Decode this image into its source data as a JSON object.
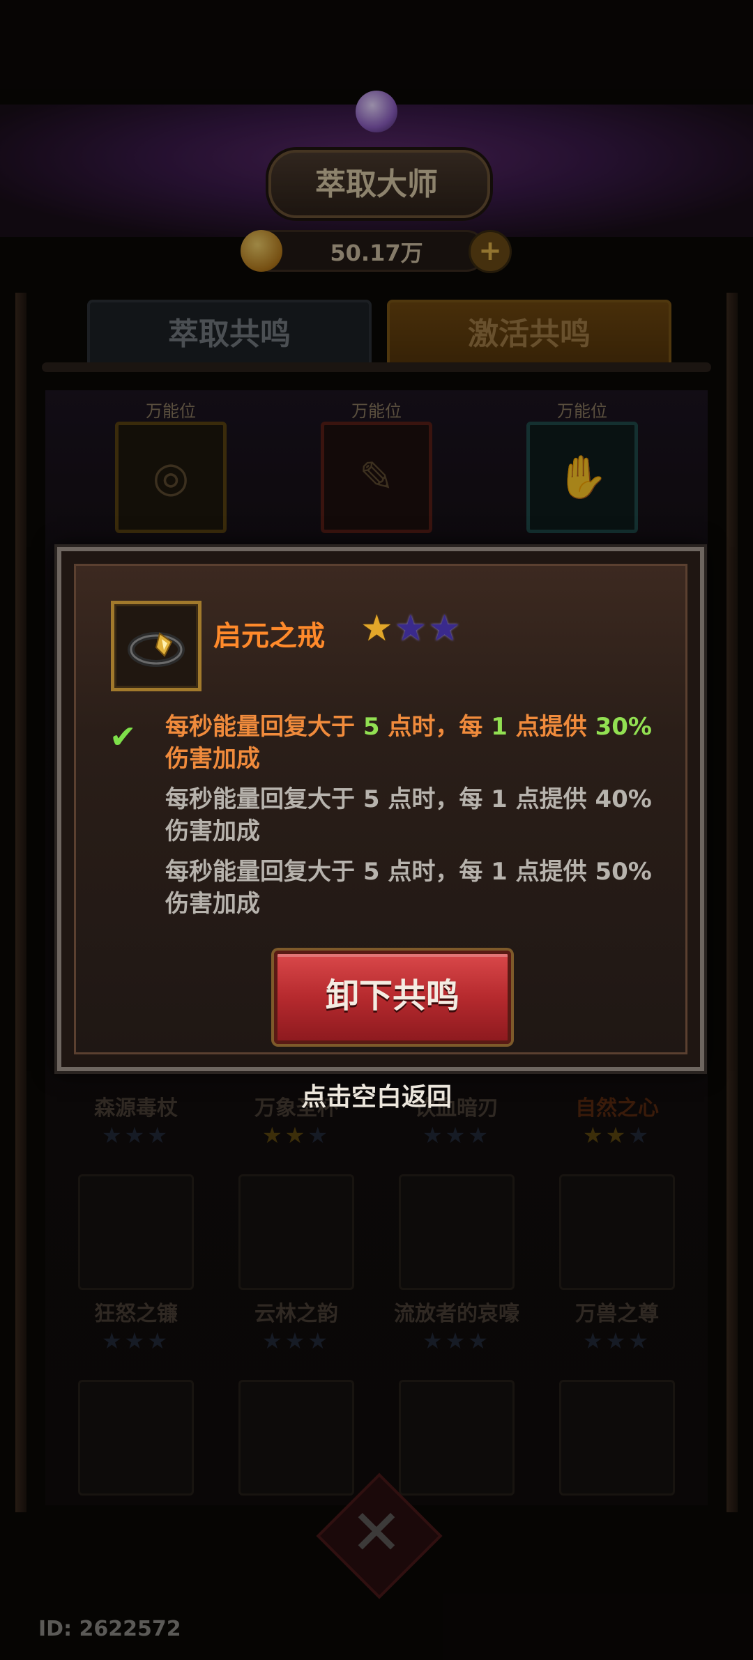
{
  "header": {
    "title": "萃取大师",
    "currency_amount": "50.17万",
    "add_button": "+"
  },
  "tabs": [
    {
      "label": "萃取共鸣",
      "state": "inactive"
    },
    {
      "label": "激活共鸣",
      "state": "active"
    }
  ],
  "slots": [
    {
      "label": "万能位",
      "color": "#5a4212"
    },
    {
      "label": "万能位",
      "color": "#5a1f17"
    },
    {
      "label": "万能位",
      "color": "#1f4b4a"
    }
  ],
  "grid_rows": [
    [
      {
        "name": "森源毒杖",
        "stars_on": 0
      },
      {
        "name": "万象圣杯",
        "stars_on": 2
      },
      {
        "name": "饮血暗刃",
        "stars_on": 0
      },
      {
        "name": "自然之心",
        "stars_on": 2
      }
    ],
    [
      {
        "name": "狂怒之镰",
        "stars_on": 0
      },
      {
        "name": "云林之韵",
        "stars_on": 0
      },
      {
        "name": "流放者的哀嚎",
        "stars_on": 0
      },
      {
        "name": "万兽之尊",
        "stars_on": 0
      }
    ]
  ],
  "modal": {
    "item_name": "启元之戒",
    "item_icon": "ring-icon",
    "stars_filled": 1,
    "stars_total": 3,
    "effects": [
      {
        "active": true,
        "parts": [
          "每秒能量回复大于 ",
          "5",
          " 点时，每 ",
          "1",
          " 点提供 ",
          "30%"
        ],
        "line2": "伤害加成"
      },
      {
        "active": false,
        "text": "每秒能量回复大于 5 点时，每 1 点提供 40%",
        "line2": "伤害加成"
      },
      {
        "active": false,
        "text": "每秒能量回复大于 5 点时，每 1 点提供 50%",
        "line2": "伤害加成"
      }
    ],
    "unequip_button": "卸下共鸣"
  },
  "tap_hint": "点击空白返回",
  "user_id": "ID: 2622572",
  "colors": {
    "accent_orange": "#ff8a2b",
    "highlight_green": "#92e052",
    "button_red": "#b62a2e"
  }
}
